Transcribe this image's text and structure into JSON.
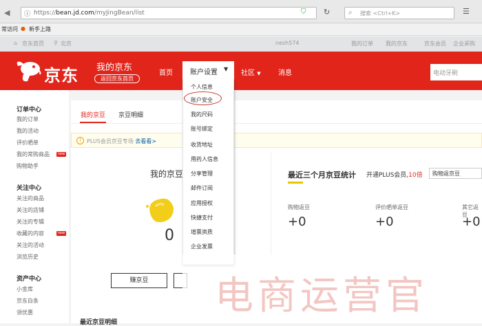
{
  "browser": {
    "url_prefix": "https://",
    "url_domain": "bean.jd.com",
    "url_path": "/myJingBean/list",
    "search_placeholder": "搜索 <Ctrl+K>",
    "bookmarks": [
      "常访问",
      "新手上路"
    ]
  },
  "topbar": {
    "home": "京东首页",
    "location": "北京",
    "user": "nesh574",
    "my_orders": "我的订单",
    "my_jd": "我的京东",
    "member": "京东会员",
    "enterprise": "企业采购"
  },
  "header": {
    "logo": "京东",
    "title": "我的京东",
    "back_home": "返回京东首页",
    "nav": [
      "首页",
      "账户设置",
      "社区",
      "消息"
    ],
    "search_placeholder": "电动牙刷"
  },
  "dropdown": {
    "items": [
      "个人信息",
      "账户安全",
      "我的尺码",
      "账号绑定",
      "收货地址",
      "用药人信息",
      "分享管理",
      "邮件订阅",
      "应用授权",
      "快捷支付",
      "增票资质",
      "企业发票"
    ]
  },
  "sidebar": {
    "sections": [
      {
        "title": "订单中心",
        "items": [
          "我的订单",
          "我的活动",
          "评价晒单",
          "我的常购商品",
          "购物助手"
        ]
      },
      {
        "title": "关注中心",
        "items": [
          "关注的商品",
          "关注的店铺",
          "关注的专辑",
          "收藏的内容",
          "关注的活动",
          "浏览历史"
        ]
      },
      {
        "title": "资产中心",
        "items": [
          "小金库",
          "京东白条",
          "领优惠"
        ]
      }
    ],
    "new_badge": "new"
  },
  "main": {
    "tabs": [
      "我的京豆",
      "京豆明细"
    ],
    "plus_notice": "PLUS会员京豆专场",
    "plus_link": "去看看>",
    "bean_title": "我的京豆",
    "bean_count": "0",
    "buy_button": "赚京豆",
    "detail_title": "最近京豆明细",
    "stats_title": "最近三个月京豆统计",
    "plus_bean_prefix": "开通PLUS会员,",
    "plus_bean_value": "10倍",
    "plus_button": "购物返京豆",
    "stats": [
      {
        "label": "购物返豆",
        "value": "+0"
      },
      {
        "label": "评价晒单返豆",
        "value": "+0"
      },
      {
        "label": "其它返豆",
        "value": "+0"
      }
    ]
  },
  "watermark": "电商运营官",
  "colors": {
    "brand_red": "#e1251b",
    "highlight": "#c43a2c"
  }
}
